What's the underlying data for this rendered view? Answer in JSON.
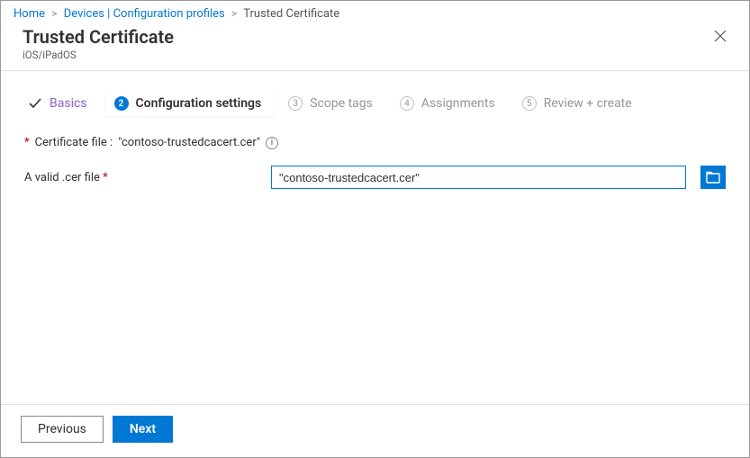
{
  "breadcrumb": {
    "home": "Home",
    "devices": "Devices | Configuration profiles",
    "current": "Trusted Certificate"
  },
  "header": {
    "title": "Trusted Certificate",
    "subtitle": "iOS/iPadOS"
  },
  "steps": [
    {
      "num": "",
      "label": "Basics",
      "state": "done"
    },
    {
      "num": "2",
      "label": "Configuration settings",
      "state": "current"
    },
    {
      "num": "3",
      "label": "Scope tags",
      "state": "pending"
    },
    {
      "num": "4",
      "label": "Assignments",
      "state": "pending"
    },
    {
      "num": "5",
      "label": "Review + create",
      "state": "pending"
    }
  ],
  "cert_file": {
    "prefix": "Certificate file :",
    "name": "\"contoso-trustedcacert.cer\""
  },
  "form": {
    "valid_cer_label": "A valid .cer file",
    "value": "\"contoso-trustedcacert.cer\""
  },
  "footer": {
    "previous": "Previous",
    "next": "Next"
  }
}
